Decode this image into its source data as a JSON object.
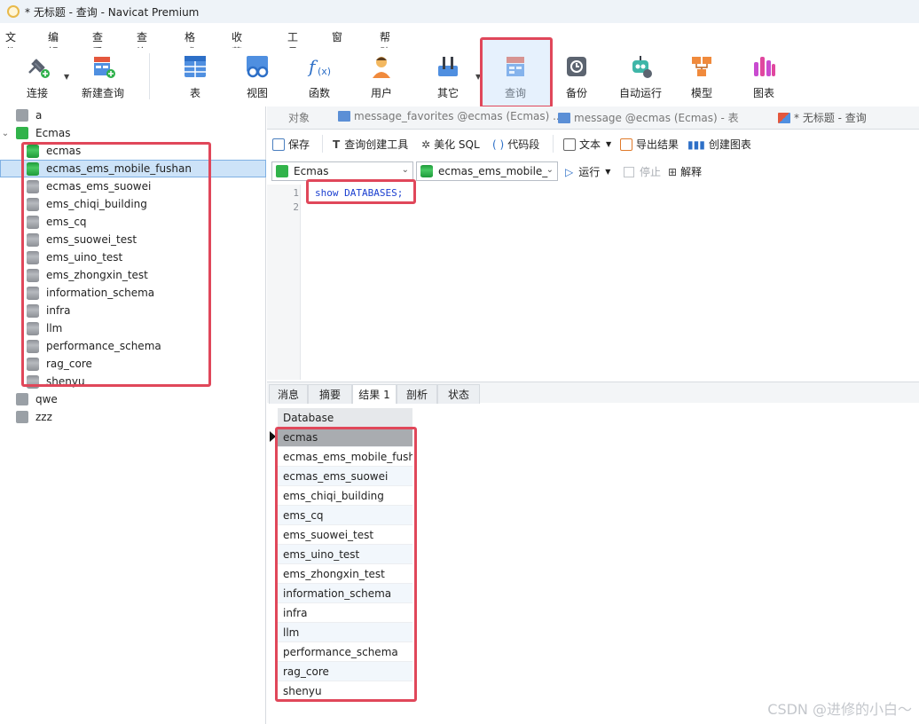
{
  "window": {
    "title": "* 无标题 - 查询 - Navicat Premium"
  },
  "menu": [
    "文件",
    "编辑",
    "查看",
    "查询",
    "格式",
    "收藏夹",
    "工具",
    "窗口",
    "帮助"
  ],
  "toolbar": {
    "connect": "连接",
    "new_query": "新建查询",
    "table": "表",
    "view": "视图",
    "function": "函数",
    "user": "用户",
    "other": "其它",
    "query": "查询",
    "backup": "备份",
    "automation": "自动运行",
    "model": "模型",
    "chart": "图表"
  },
  "tree": {
    "connections": [
      {
        "name": "a"
      },
      {
        "name": "Ecmas"
      },
      {
        "name": "qwe"
      },
      {
        "name": "zzz"
      }
    ],
    "ecmas_databases": [
      "ecmas",
      "ecmas_ems_mobile_fushan",
      "ecmas_ems_suowei",
      "ems_chiqi_building",
      "ems_cq",
      "ems_suowei_test",
      "ems_uino_test",
      "ems_zhongxin_test",
      "information_schema",
      "infra",
      "llm",
      "performance_schema",
      "rag_core",
      "shenyu"
    ]
  },
  "doc_tabs": {
    "objects": "对象",
    "tab1": "message_favorites @ecmas (Ecmas) ...",
    "tab2": "message @ecmas (Ecmas) - 表",
    "tab3": "* 无标题 - 查询"
  },
  "query_toolbar": {
    "save": "保存",
    "builder": "查询创建工具",
    "beautify": "美化 SQL",
    "snippet": "代码段",
    "text": "文本",
    "export": "导出结果",
    "create_chart": "创建图表"
  },
  "selectors": {
    "connection": "Ecmas",
    "database": "ecmas_ems_mobile_",
    "run": "运行",
    "stop": "停止",
    "explain": "解释"
  },
  "editor": {
    "line_numbers": [
      "1",
      "2"
    ],
    "code": "show DATABASES;"
  },
  "result_tabs": [
    "消息",
    "摘要",
    "结果 1",
    "剖析",
    "状态"
  ],
  "grid": {
    "column": "Database",
    "rows": [
      "ecmas",
      "ecmas_ems_mobile_fush",
      "ecmas_ems_suowei",
      "ems_chiqi_building",
      "ems_cq",
      "ems_suowei_test",
      "ems_uino_test",
      "ems_zhongxin_test",
      "information_schema",
      "infra",
      "llm",
      "performance_schema",
      "rag_core",
      "shenyu"
    ]
  },
  "watermark": "CSDN @进修的小白～"
}
